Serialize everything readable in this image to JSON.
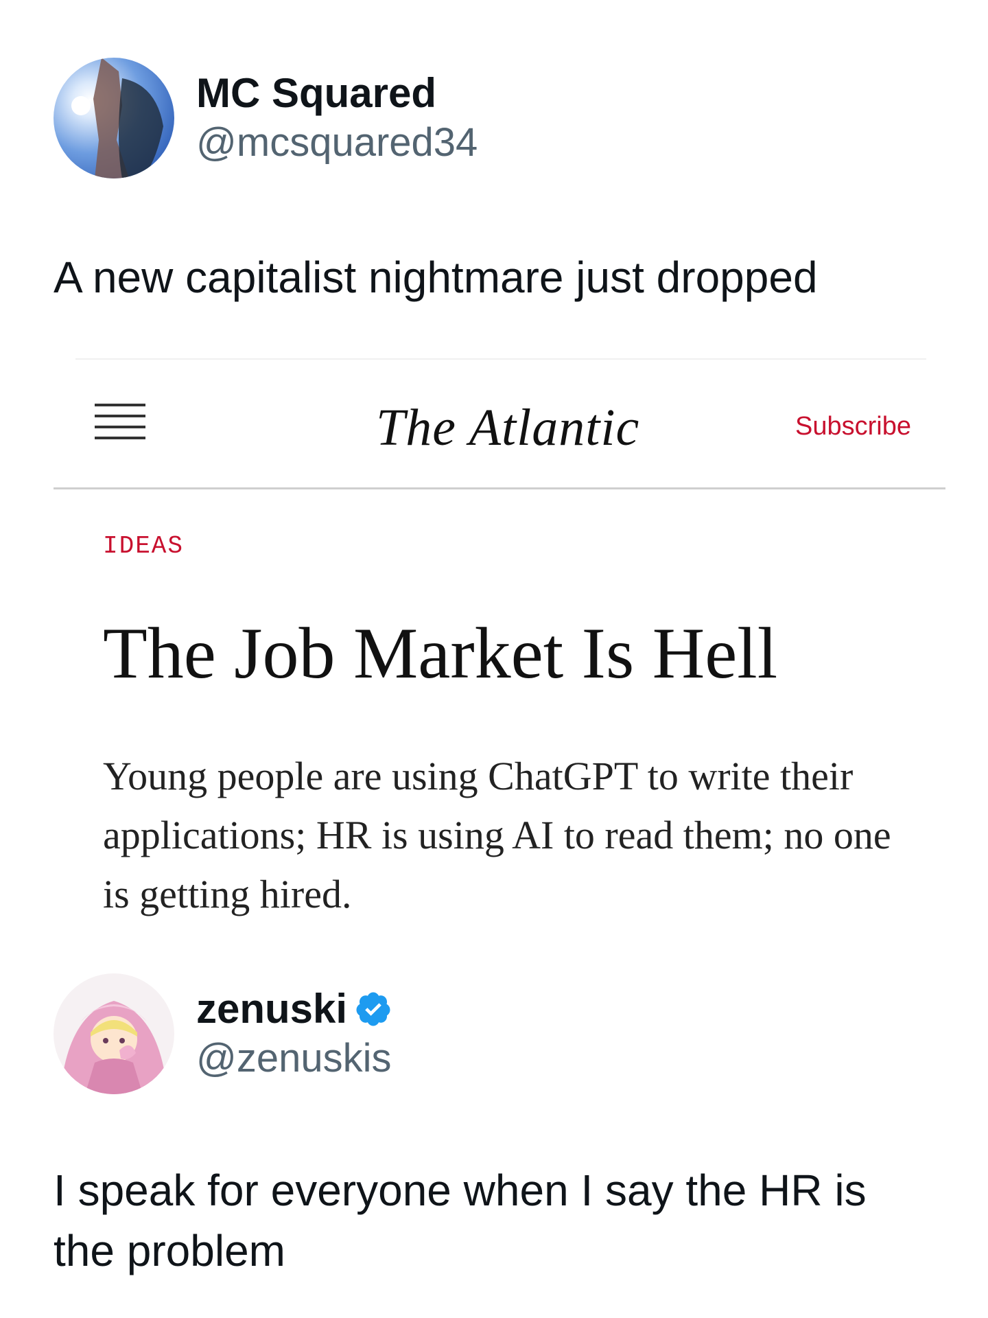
{
  "tweet": {
    "display_name": "MC Squared",
    "handle": "@mcsquared34",
    "text": "A new capitalist nightmare just dropped"
  },
  "embedded_article": {
    "publication": "The Atlantic",
    "subscribe_label": "Subscribe",
    "section": "IDEAS",
    "title": "The Job Market Is Hell",
    "dek": "Young people are using ChatGPT to write their applications; HR is using AI to read them; no one is getting hired.",
    "accent_color": "#c8102e",
    "icons": [
      "hamburger-menu-icon"
    ]
  },
  "reply": {
    "display_name": "zenuski",
    "handle": "@zenuskis",
    "verified": true,
    "verified_color": "#1d9bf0",
    "text": "I speak for everyone when I say the HR is the problem"
  }
}
